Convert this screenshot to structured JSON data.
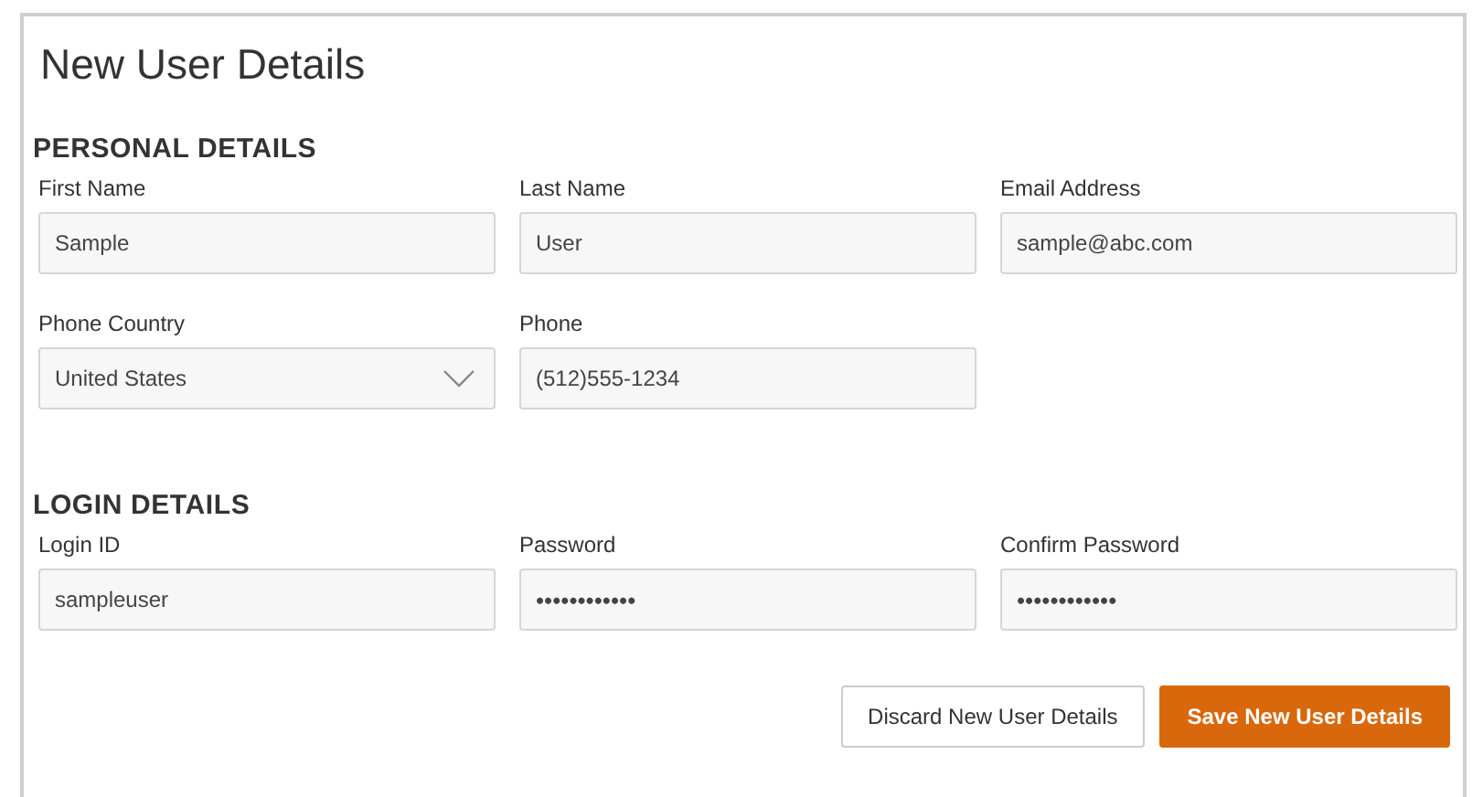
{
  "title": "New User Details",
  "sections": [
    {
      "heading": "PERSONAL DETAILS",
      "rows": [
        [
          {
            "label": "First Name",
            "kind": "text",
            "value": "Sample"
          },
          {
            "label": "Last Name",
            "kind": "text",
            "value": "User"
          },
          {
            "label": "Email Address",
            "kind": "text",
            "value": "sample@abc.com"
          }
        ],
        [
          {
            "label": "Phone Country",
            "kind": "select",
            "value": "United States"
          },
          {
            "label": "Phone",
            "kind": "text",
            "value": "(512)555-1234"
          }
        ]
      ]
    },
    {
      "heading": "LOGIN DETAILS",
      "rows": [
        [
          {
            "label": "Login ID",
            "kind": "text",
            "value": "sampleuser"
          },
          {
            "label": "Password",
            "kind": "password",
            "value": "••••••••••••"
          },
          {
            "label": "Confirm Password",
            "kind": "password",
            "value": "••••••••••••"
          }
        ]
      ]
    }
  ],
  "buttons": [
    {
      "label": "Discard New User Details",
      "kind": "secondary"
    },
    {
      "label": "Save New User Details",
      "kind": "primary"
    }
  ]
}
